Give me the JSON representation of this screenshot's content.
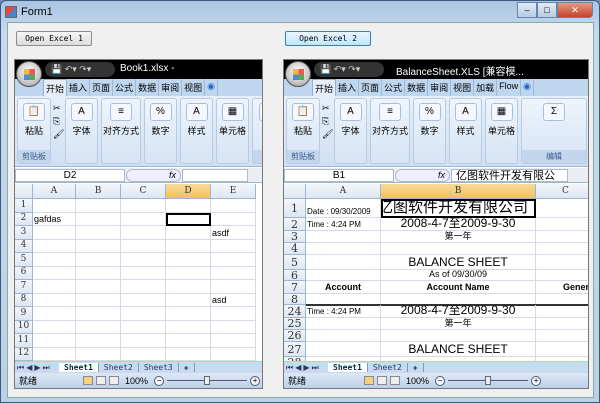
{
  "window": {
    "title": "Form1",
    "buttons": [
      "minimize",
      "maximize",
      "close"
    ]
  },
  "open_buttons": [
    "Open Excel 1",
    "Open Excel 2"
  ],
  "excel1": {
    "filename": "Book1.xlsx -",
    "tabs": [
      "开始",
      "插入",
      "页面",
      "公式",
      "数据",
      "审阅",
      "视图"
    ],
    "groups": [
      {
        "label": "粘贴",
        "footer": "剪贴板"
      },
      {
        "label": "字体"
      },
      {
        "label": "对齐方式"
      },
      {
        "label": "数字"
      },
      {
        "label": "样式"
      },
      {
        "label": "单元格"
      },
      {
        "label": "",
        "footer": "编"
      }
    ],
    "name_box": "D2",
    "formula": "",
    "columns": [
      "A",
      "B",
      "C",
      "D",
      "E"
    ],
    "rows": [
      "1",
      "2",
      "3",
      "4",
      "5",
      "6",
      "7",
      "8",
      "9",
      "10",
      "11",
      "12"
    ],
    "cells": {
      "A2": "gafdas",
      "E3": "asdf",
      "E8": "asd"
    },
    "selected": "D2",
    "sheets": [
      "Sheet1",
      "Sheet2",
      "Sheet3"
    ],
    "status": "就绪",
    "zoom": "100%"
  },
  "excel2": {
    "filename": "BalanceSheet.XLS  [兼容模...",
    "tabs": [
      "开始",
      "插入",
      "页面",
      "公式",
      "数据",
      "审阅",
      "视图",
      "加载",
      "Flow"
    ],
    "groups": [
      {
        "label": "粘贴",
        "footer": "剪贴板"
      },
      {
        "label": "字体"
      },
      {
        "label": "对齐方式"
      },
      {
        "label": "数字"
      },
      {
        "label": "样式"
      },
      {
        "label": "单元格"
      },
      {
        "label": "",
        "footer": "编辑"
      }
    ],
    "name_box": "B1",
    "formula": "亿图软件开发有限公",
    "columns": [
      "A",
      "B",
      "C"
    ],
    "rows": [
      "1",
      "2",
      "3",
      "4",
      "5",
      "6",
      "7",
      "8",
      "24",
      "25",
      "26",
      "27",
      "28"
    ],
    "cells": {
      "A1": "Date : 09/30/2009",
      "B1": "亿图软件开发有限公司",
      "A2": "Time :  4:24 PM",
      "B2": "2008-4-7至2009-9-30",
      "B3": "第一年",
      "B5": "BALANCE SHEET",
      "B6": "As of 09/30/09",
      "A7": "Account",
      "B7": "Account Name",
      "C7": "Genera",
      "A24": "Time :  4:24 PM",
      "B24": "2008-4-7至2009-9-30",
      "B25": "第一年",
      "B27": "BALANCE SHEET"
    },
    "selected": "B1",
    "sheets": [
      "Sheet1",
      "Sheet2"
    ],
    "status": "就绪",
    "zoom": "100%"
  }
}
